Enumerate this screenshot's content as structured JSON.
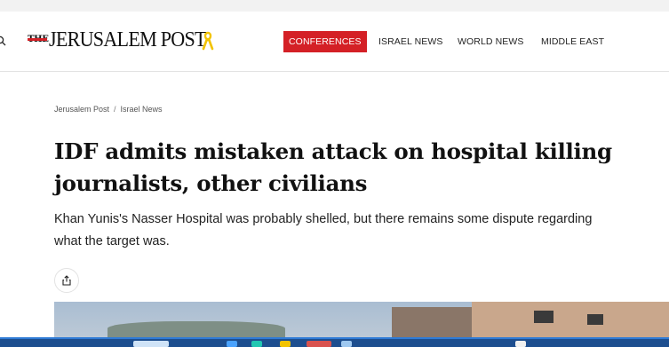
{
  "header": {
    "logo_the": "THE",
    "logo_main": "JERUSALEM POST",
    "nav": [
      {
        "label": "CONFERENCES",
        "highlight": true
      },
      {
        "label": "ISRAEL NEWS"
      },
      {
        "label": "WORLD NEWS"
      },
      {
        "label": "MIDDLE EAST"
      }
    ]
  },
  "breadcrumb": {
    "home": "Jerusalem Post",
    "separator": "/",
    "section": "Israel News"
  },
  "article": {
    "headline": "IDF admits mistaken attack on hospital killing journalists, other civilians",
    "subhead": "Khan Yunis's Nasser Hospital was probably shelled, but there remains some dispute regarding what the target was."
  },
  "icons": {
    "search": "search-icon",
    "ribbon": "yellow-ribbon-icon",
    "share": "share-icon"
  },
  "colors": {
    "brand_red": "#d42026",
    "ribbon_yellow": "#f2c300",
    "taskbar": "#1d4e8f"
  }
}
